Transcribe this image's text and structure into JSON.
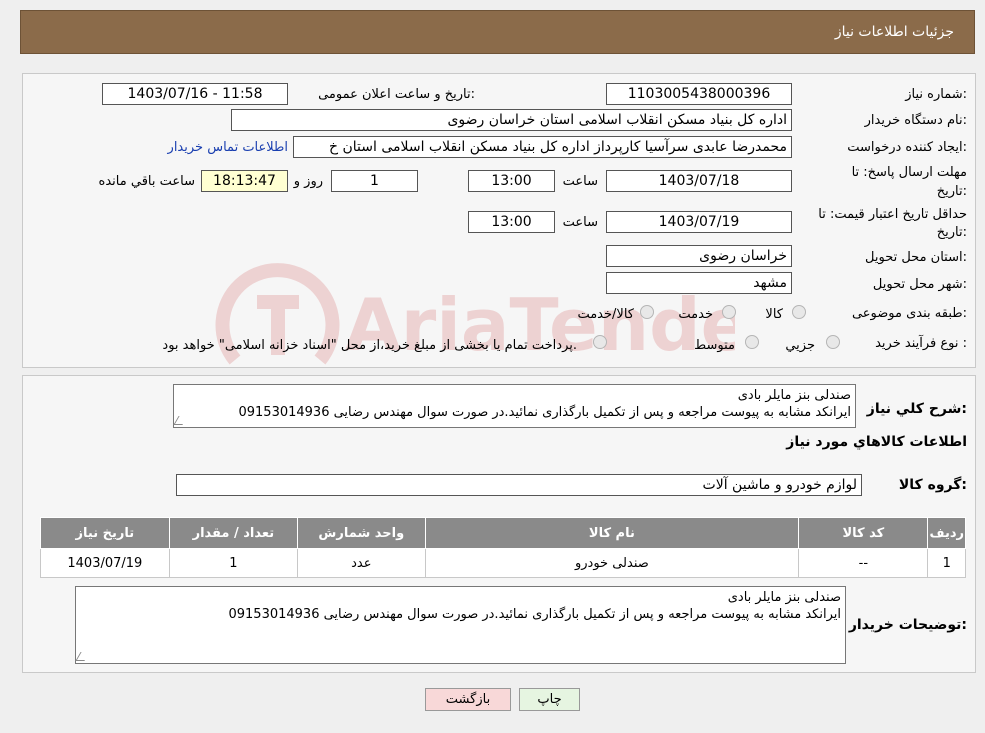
{
  "header": {
    "title": "جزئیات اطلاعات نیاز"
  },
  "form": {
    "need_number_label": "شماره نیاز:",
    "need_number": "1103005438000396",
    "announce_label": "تاریخ و ساعت اعلان عمومی:",
    "announce_value": "1403/07/16 - 11:58",
    "buyer_org_label": "نام دستگاه خریدار:",
    "buyer_org": "اداره کل بنیاد مسکن انقلاب اسلامی استان خراسان رضوی",
    "creator_label": "ایجاد کننده درخواست:",
    "creator": "محمدرضا عابدی سرآسیا کارپرداز اداره کل بنیاد مسکن انقلاب اسلامی استان خ",
    "contact_link": "اطلاعات تماس خریدار",
    "deadline_label_1": "مهلت ارسال پاسخ: تا",
    "deadline_label_2": "تاریخ:",
    "deadline_date": "1403/07/18",
    "time_label": "ساعت",
    "deadline_time": "13:00",
    "days_value": "1",
    "days_label": "روز و",
    "remaining_value": "18:13:47",
    "remaining_label": "ساعت باقي مانده",
    "validity_label_1": "حداقل تاریخ اعتبار قیمت: تا",
    "validity_label_2": "تاریخ:",
    "validity_date": "1403/07/19",
    "validity_time": "13:00",
    "province_label": "استان محل تحویل:",
    "province": "خراسان رضوی",
    "city_label": "شهر محل تحویل:",
    "city": "مشهد",
    "category_label": "طبقه بندی موضوعی:",
    "category_options": [
      "کالا",
      "خدمت",
      "کالا/خدمت"
    ],
    "process_label": "نوع فرآیند خرید :",
    "process_options": [
      "جزیي",
      "متوسط"
    ],
    "process_note": "پرداخت تمام یا بخشی از مبلغ خرید،از محل \"اسناد خزانه اسلامی\" خواهد بود."
  },
  "description": {
    "label": "شرح کلي نياز:",
    "line1": "صندلی بنز مایلر بادی",
    "line2": "ایرانکد مشابه به پیوست مراجعه و پس از تکمیل بارگذاری نمائید.در صورت سوال مهندس رضایی 09153014936"
  },
  "goods": {
    "section_title": "اطلاعات کالاهاي مورد نياز",
    "group_label": "گروه کالا:",
    "group_value": "لوازم خودرو و ماشین آلات",
    "table": {
      "headers": [
        "رديف",
        "کد کالا",
        "نام کالا",
        "واحد شمارش",
        "تعداد / مقدار",
        "تاريخ نياز"
      ],
      "rows": [
        [
          "1",
          "--",
          "صندلی خودرو",
          "عدد",
          "1",
          "1403/07/19"
        ]
      ]
    }
  },
  "buyer_notes": {
    "label": "توضیحات خریدار:",
    "line1": "صندلی بنز مایلر بادی",
    "line2": "ایرانکد مشابه به پیوست مراجعه و پس از تکمیل بارگذاری نمائید.در صورت سوال مهندس رضایی 09153014936"
  },
  "buttons": {
    "print": "چاپ",
    "back": "بازگشت"
  },
  "watermark": "AriaTender.neT",
  "colors": {
    "header": "#8b6b4a",
    "link": "#1a3fb0",
    "table_header": "#8a8a8a",
    "back_button": "#f8d8d8",
    "print_button": "#e6f5e1"
  }
}
